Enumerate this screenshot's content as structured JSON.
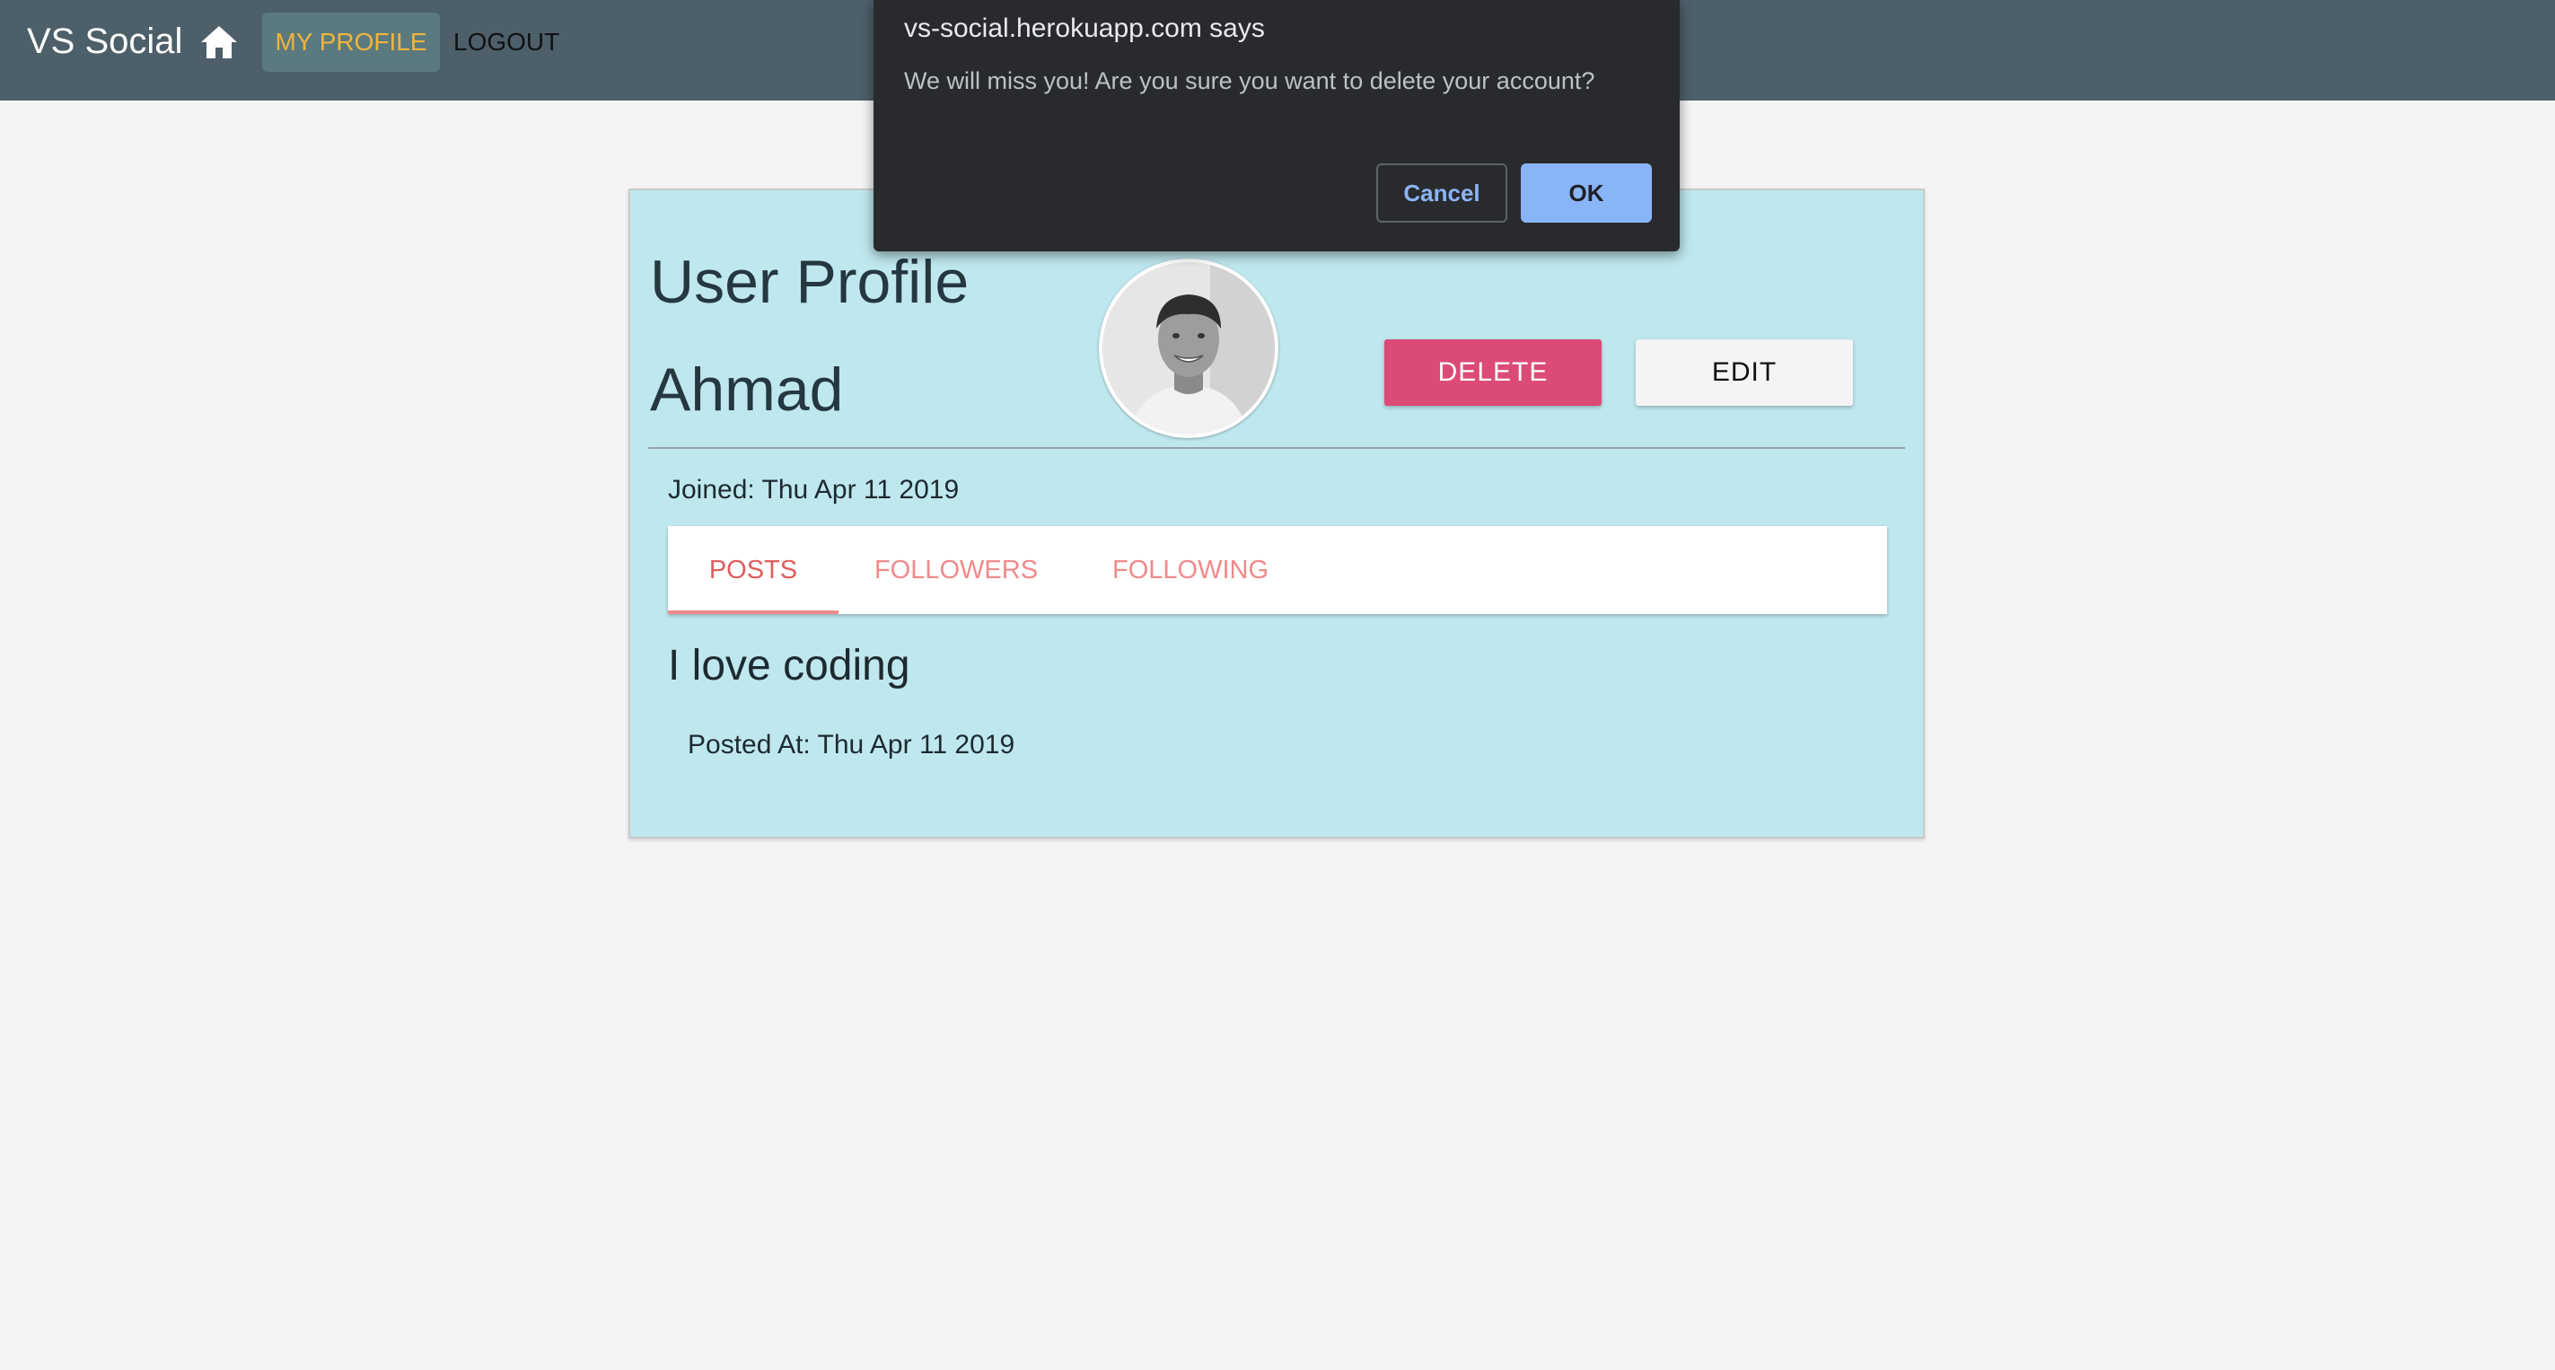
{
  "navbar": {
    "brand": "VS Social",
    "home_icon": "home-icon",
    "my_profile_label": "MY PROFILE",
    "logout_label": "LOGOUT",
    "background_color": "#4d5f69",
    "active_color": "#f0b43c"
  },
  "profile": {
    "title": "User Profile",
    "name": "Ahmad",
    "delete_label": "DELETE",
    "edit_label": "EDIT",
    "joined_text": "Joined: Thu Apr 11 2019",
    "card_color": "#bfe8ee",
    "delete_color": "#dc4a78"
  },
  "tabs": {
    "items": [
      {
        "label": "POSTS",
        "active": true
      },
      {
        "label": "FOLLOWERS",
        "active": false
      },
      {
        "label": "FOLLOWING",
        "active": false
      }
    ],
    "accent_color": "#f08a8a"
  },
  "post": {
    "title": "I love coding",
    "posted_at": "Posted At: Thu Apr 11 2019"
  },
  "dialog": {
    "title": "vs-social.herokuapp.com says",
    "message": "We will miss you! Are you sure you want to delete your account?",
    "cancel_label": "Cancel",
    "ok_label": "OK"
  }
}
